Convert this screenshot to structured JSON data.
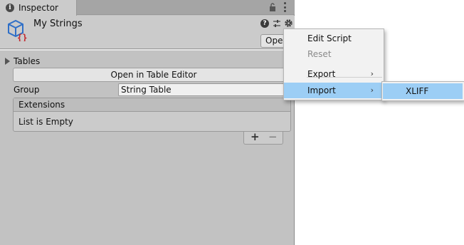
{
  "window": {
    "tab_title": "Inspector"
  },
  "header": {
    "asset_name": "My Strings",
    "open_button_label": "Open"
  },
  "tables": {
    "label": "Tables",
    "open_table_editor_label": "Open in Table Editor",
    "group_label": "Group",
    "group_value": "String Table"
  },
  "extensions": {
    "header": "Extensions",
    "empty_text": "List is Empty",
    "add_label": "+",
    "remove_label": "−"
  },
  "context_menu": {
    "items": [
      {
        "label": "Edit Script",
        "enabled": true
      },
      {
        "label": "Reset",
        "enabled": false
      },
      {
        "label": "Export",
        "enabled": true,
        "has_submenu": true
      },
      {
        "label": "Import",
        "enabled": true,
        "has_submenu": true,
        "selected": true
      }
    ],
    "submenu_arrow": "›"
  },
  "submenu": {
    "items": [
      {
        "label": "XLIFF",
        "selected": true
      }
    ]
  },
  "icons": {
    "tab": "info-icon",
    "lock": "lock-icon",
    "kebab": "kebab-menu-icon",
    "asset": "localization-table-icon",
    "help": "help-icon",
    "presets": "presets-icon",
    "settings": "gear-icon"
  },
  "colors": {
    "selection": "#9ccef5",
    "panel": "#c2c2c2",
    "menu_bg": "#f2f2f2",
    "asset_icon_blue": "#2f6fc7",
    "asset_icon_red": "#c2272d"
  }
}
